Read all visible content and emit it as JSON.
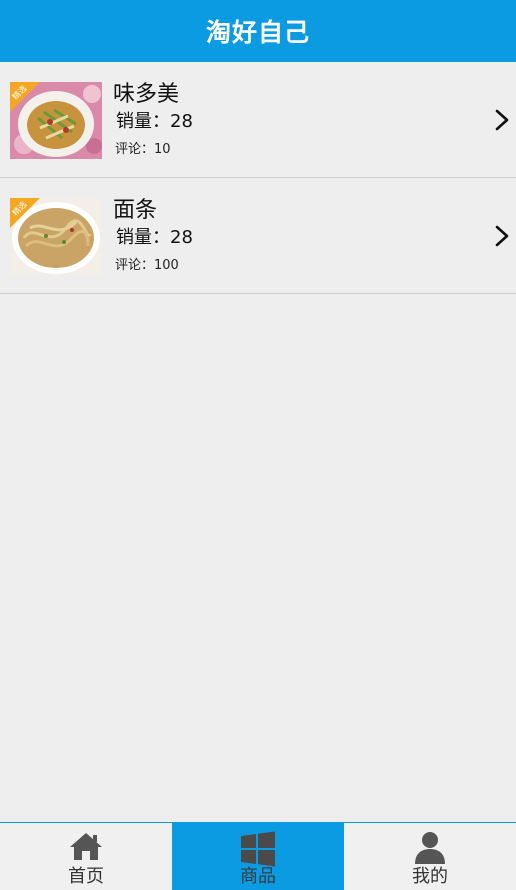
{
  "header": {
    "title": "淘好自己"
  },
  "products": [
    {
      "name": "味多美",
      "sales": "销量：28",
      "reviews": "评论：10",
      "badge": "精选"
    },
    {
      "name": "面条",
      "sales": "销量：28",
      "reviews": "评论：100",
      "badge": "精选"
    }
  ],
  "tabs": [
    {
      "label": "首页",
      "icon": "home-icon",
      "active": false
    },
    {
      "label": "商品",
      "icon": "windows-icon",
      "active": true
    },
    {
      "label": "我的",
      "icon": "user-icon",
      "active": false
    }
  ],
  "colors": {
    "accent": "#0b9be2",
    "background": "#eeeeee",
    "badge": "#f5a623"
  }
}
